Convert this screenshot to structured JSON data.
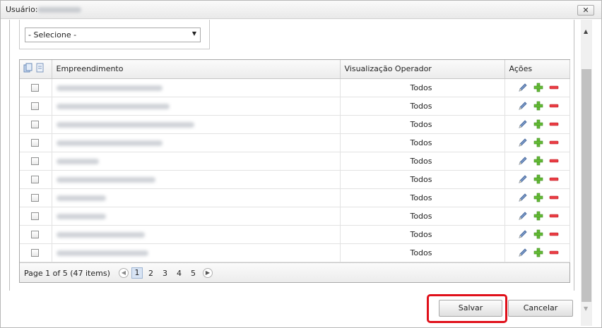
{
  "dialog": {
    "title_label": "Usuário:",
    "close_label": "✕"
  },
  "filter": {
    "select_value": "- Selecione -"
  },
  "grid": {
    "columns": {
      "empreendimento": "Empreendimento",
      "visualizacao": "Visualização Operador",
      "acoes": "Ações"
    },
    "rows": [
      {
        "visualizacao": "Todos"
      },
      {
        "visualizacao": "Todos"
      },
      {
        "visualizacao": "Todos"
      },
      {
        "visualizacao": "Todos"
      },
      {
        "visualizacao": "Todos"
      },
      {
        "visualizacao": "Todos"
      },
      {
        "visualizacao": "Todos"
      },
      {
        "visualizacao": "Todos"
      },
      {
        "visualizacao": "Todos"
      },
      {
        "visualizacao": "Todos"
      }
    ],
    "icons": {
      "edit": "pencil-icon",
      "add": "plus-icon",
      "remove": "minus-icon",
      "copy": "copy-icon",
      "document": "document-icon"
    }
  },
  "pager": {
    "info": "Page 1 of 5 (47 items)",
    "pages": [
      "1",
      "2",
      "3",
      "4",
      "5"
    ],
    "current": "1"
  },
  "buttons": {
    "save": "Salvar",
    "cancel": "Cancelar"
  },
  "colors": {
    "highlight": "#e0101a",
    "edit_icon": "#4a6fa5",
    "add_icon": "#5cb531",
    "remove_icon": "#e3363d"
  }
}
